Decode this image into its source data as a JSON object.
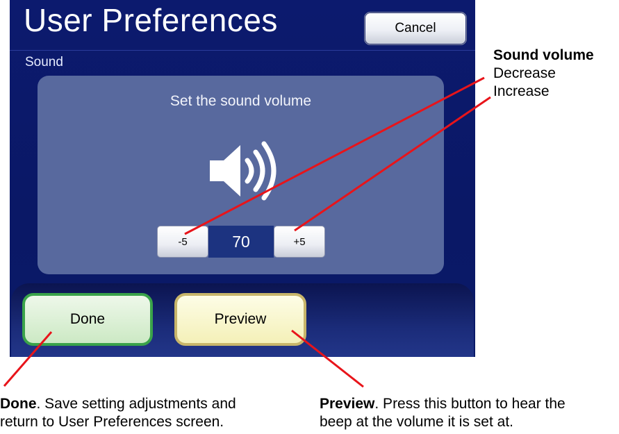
{
  "window": {
    "title": "User Preferences",
    "cancel_label": "Cancel"
  },
  "section": {
    "label": "Sound"
  },
  "panel": {
    "heading": "Set the sound volume"
  },
  "volume": {
    "decrease_label": "-5",
    "value": "70",
    "increase_label": "+5"
  },
  "actions": {
    "done_label": "Done",
    "preview_label": "Preview"
  },
  "annotations": {
    "sound_volume": {
      "title": "Sound volume",
      "decrease": "Decrease",
      "increase": "Increase"
    },
    "done": {
      "term": "Done",
      "line1_rest": ". Save setting adjustments and",
      "line2": "return to User Preferences screen."
    },
    "preview": {
      "term": "Preview",
      "line1_rest": ". Press this button to hear the",
      "line2": "beep at the volume it is set at."
    }
  },
  "colors": {
    "screen_bg": "#0c1a6e",
    "panel_bg": "#58699e",
    "volume_value_bg": "#1c3380",
    "done_border": "#3aa34a",
    "preview_border": "#c7b56a",
    "callout_line": "#e8141a"
  },
  "icons": {
    "speaker": "speaker-volume-icon"
  }
}
